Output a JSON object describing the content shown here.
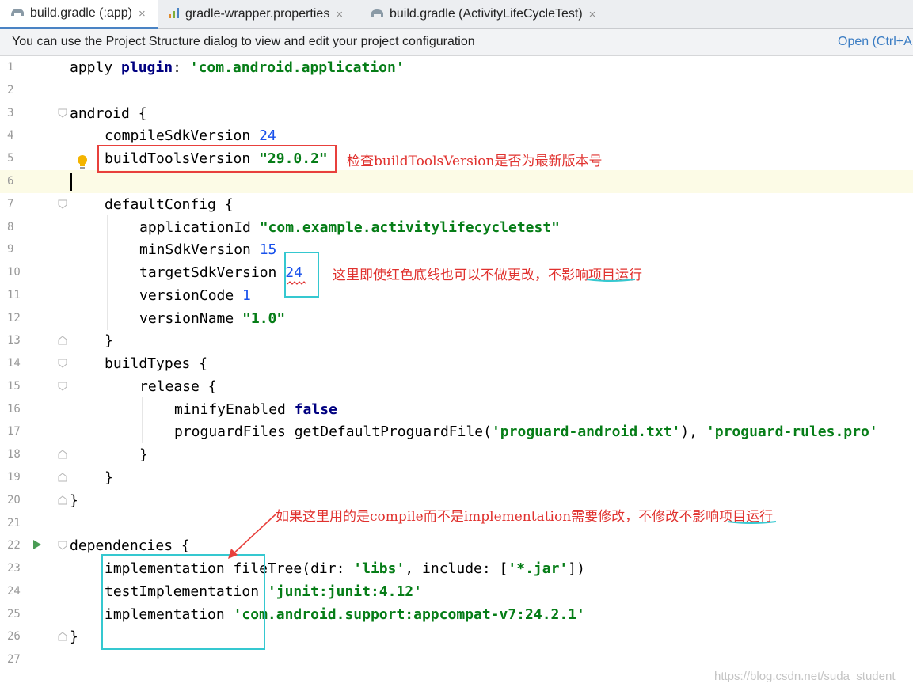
{
  "tabs": [
    {
      "label": "build.gradle (:app)",
      "icon": "gradle-elephant-icon",
      "active": true
    },
    {
      "label": "gradle-wrapper.properties",
      "icon": "properties-file-icon",
      "active": false
    },
    {
      "label": "build.gradle (ActivityLifeCycleTest)",
      "icon": "gradle-elephant-icon",
      "active": false
    }
  ],
  "tab_close_glyph": "×",
  "notification": {
    "message": "You can use the Project Structure dialog to view and edit your project configuration",
    "link": "Open (Ctrl+A"
  },
  "line_numbers": [
    "1",
    "2",
    "3",
    "4",
    "5",
    "6",
    "7",
    "8",
    "9",
    "10",
    "11",
    "12",
    "13",
    "14",
    "15",
    "16",
    "17",
    "18",
    "19",
    "20",
    "21",
    "22",
    "23",
    "24",
    "25",
    "26",
    "27"
  ],
  "code": {
    "l1": [
      "apply ",
      "plugin",
      ": ",
      "'com.android.application'"
    ],
    "l3": "android {",
    "l4": [
      "compileSdkVersion ",
      "24"
    ],
    "l5": [
      "buildToolsVersion ",
      "\"29.0.2\""
    ],
    "l7": "defaultConfig {",
    "l8": [
      "applicationId ",
      "\"com.example.activitylifecycletest\""
    ],
    "l9": [
      "minSdkVersion ",
      "15"
    ],
    "l10": [
      "targetSdkVersion ",
      "24"
    ],
    "l11": [
      "versionCode ",
      "1"
    ],
    "l12": [
      "versionName ",
      "\"1.0\""
    ],
    "l13": "}",
    "l14": "buildTypes {",
    "l15": "release {",
    "l16": [
      "minifyEnabled ",
      "false"
    ],
    "l17": [
      "proguardFiles getDefaultProguardFile(",
      "'proguard-android.txt'",
      "), ",
      "'proguard-rules.pro'"
    ],
    "l18": "}",
    "l19": "}",
    "l20": "}",
    "l22": "dependencies {",
    "l23": [
      "implementation fileTree(",
      "dir",
      ": ",
      "'libs'",
      ", ",
      "include",
      ": [",
      "'*.jar'",
      "])"
    ],
    "l24": [
      "testImplementation ",
      "'junit:junit:4.12'"
    ],
    "l25": [
      "implementation ",
      "'com.android.support:appcompat-v7:24.2.1'"
    ],
    "l26": "}"
  },
  "annotations": {
    "note_build_tools": "检查buildToolsVersion是否为最新版本号",
    "note_target_sdk": [
      "这里即使红色底线也可以不做更改，",
      "不影响",
      "项目运行"
    ],
    "note_dependencies": [
      "如果这里用的是compile而不是implementation需要修改，不修改",
      "不影响",
      "项目运行"
    ]
  },
  "colors": {
    "red_box": "#e8403c",
    "cyan_box": "#35c8d0",
    "annotation_text": "#e0312e",
    "string": "#067d17",
    "number": "#1750eb",
    "keyword": "#000080"
  },
  "watermark": "https://blog.csdn.net/suda_student"
}
